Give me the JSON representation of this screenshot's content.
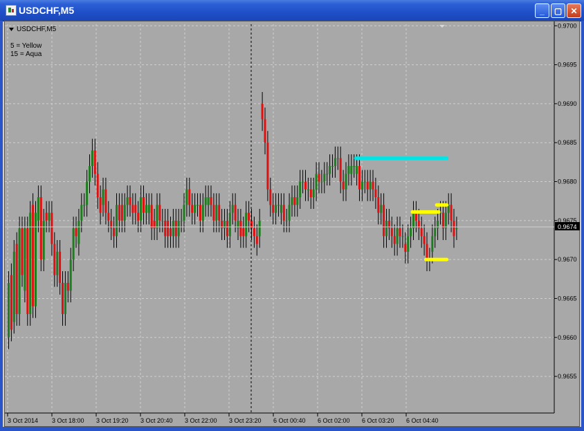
{
  "window": {
    "title": "USDCHF,M5"
  },
  "chart_header": {
    "symbol_label": "USDCHF,M5"
  },
  "legend": {
    "line1": "5 = Yellow",
    "line2": "15 = Aqua"
  },
  "current_price": "0.9674",
  "colors": {
    "bg": "#a8a8a8",
    "grid": "#d0d0d0",
    "bull": "#1e7d1e",
    "bear": "#e01010",
    "yellow": "#ffff00",
    "aqua": "#00e5e5"
  },
  "chart_data": {
    "type": "candlestick",
    "timeframe": "M5",
    "title": "USDCHF,M5",
    "ylim": [
      0.96503,
      0.97002
    ],
    "y_ticks": [
      "0.9700",
      "0.9695",
      "0.9690",
      "0.9685",
      "0.9680",
      "0.9675",
      "0.9670",
      "0.9665",
      "0.9660",
      "0.9655"
    ],
    "x_ticks": [
      "3 Oct 2014",
      "3 Oct 18:00",
      "3 Oct 19:20",
      "3 Oct 20:40",
      "3 Oct 22:00",
      "3 Oct 23:20",
      "6 Oct 00:40",
      "6 Oct 02:00",
      "6 Oct 03:20",
      "6 Oct 04:40"
    ],
    "closes": [
      0.9667,
      0.9661,
      0.9671,
      0.9663,
      0.9674,
      0.9668,
      0.9674,
      0.9663,
      0.9676,
      0.9664,
      0.9676,
      0.9678,
      0.967,
      0.9675,
      0.9675,
      0.9676,
      0.9672,
      0.9668,
      0.9671,
      0.9667,
      0.9663,
      0.9667,
      0.9666,
      0.967,
      0.9674,
      0.9673,
      0.9675,
      0.9677,
      0.9677,
      0.968,
      0.9682,
      0.9684,
      0.9681,
      0.9678,
      0.9676,
      0.9679,
      0.9676,
      0.9675,
      0.9674,
      0.9673,
      0.9677,
      0.9675,
      0.9675,
      0.9677,
      0.9678,
      0.9677,
      0.9676,
      0.9676,
      0.9675,
      0.9678,
      0.9676,
      0.9677,
      0.9677,
      0.9674,
      0.9674,
      0.9677,
      0.9675,
      0.9675,
      0.9673,
      0.9673,
      0.9673,
      0.9675,
      0.9673,
      0.9675,
      0.9675,
      0.9677,
      0.9679,
      0.9677,
      0.9676,
      0.9677,
      0.9677,
      0.9675,
      0.9677,
      0.9678,
      0.9678,
      0.9677,
      0.9675,
      0.9677,
      0.9675,
      0.9674,
      0.9675,
      0.9673,
      0.9676,
      0.9677,
      0.9675,
      0.9675,
      0.9673,
      0.9673,
      0.9676,
      0.9675,
      0.9674,
      0.9673,
      0.9672,
      0.9675,
      0.9688,
      0.9685,
      0.9679,
      0.9677,
      0.9676,
      0.9677,
      0.9677,
      0.9677,
      0.9675,
      0.9675,
      0.9677,
      0.9678,
      0.9677,
      0.9678,
      0.968,
      0.968,
      0.9679,
      0.9679,
      0.9678,
      0.9679,
      0.9681,
      0.968,
      0.968,
      0.9681,
      0.9681,
      0.9682,
      0.9682,
      0.9683,
      0.9683,
      0.968,
      0.9679,
      0.9681,
      0.9682,
      0.9682,
      0.9682,
      0.9682,
      0.9679,
      0.968,
      0.968,
      0.9679,
      0.968,
      0.9679,
      0.9678,
      0.9676,
      0.9677,
      0.9673,
      0.9675,
      0.9674,
      0.9673,
      0.9672,
      0.9674,
      0.9673,
      0.9673,
      0.9671,
      0.9673,
      0.9674,
      0.9676,
      0.9675,
      0.9674,
      0.9673,
      0.9672,
      0.967,
      0.967,
      0.9673,
      0.9674,
      0.9675,
      0.9676,
      0.9674,
      0.9676,
      0.9677,
      0.9675,
      0.9673,
      0.9674
    ],
    "opens": [
      0.966,
      0.9668,
      0.9662,
      0.9672,
      0.9663,
      0.9674,
      0.9666,
      0.9674,
      0.9663,
      0.9677,
      0.9664,
      0.9675,
      0.9678,
      0.967,
      0.9676,
      0.9675,
      0.9676,
      0.9672,
      0.9668,
      0.9671,
      0.9667,
      0.9663,
      0.9667,
      0.9666,
      0.967,
      0.9674,
      0.9672,
      0.9675,
      0.9677,
      0.9677,
      0.968,
      0.9682,
      0.9684,
      0.9681,
      0.9678,
      0.9677,
      0.9679,
      0.9676,
      0.9675,
      0.9674,
      0.9673,
      0.9677,
      0.9677,
      0.9675,
      0.9677,
      0.9678,
      0.9677,
      0.9677,
      0.9676,
      0.9675,
      0.9678,
      0.9676,
      0.9676,
      0.9677,
      0.9675,
      0.9674,
      0.9677,
      0.9675,
      0.9675,
      0.9675,
      0.9674,
      0.9673,
      0.9675,
      0.9673,
      0.9675,
      0.9675,
      0.9677,
      0.9679,
      0.9677,
      0.9676,
      0.9677,
      0.9677,
      0.9675,
      0.9677,
      0.9677,
      0.9678,
      0.9677,
      0.9675,
      0.9677,
      0.9675,
      0.9674,
      0.9675,
      0.9673,
      0.9676,
      0.9677,
      0.9674,
      0.9675,
      0.9674,
      0.9673,
      0.9676,
      0.9675,
      0.9674,
      0.9673,
      0.9673,
      0.969,
      0.9688,
      0.9685,
      0.9679,
      0.9677,
      0.9676,
      0.9677,
      0.9676,
      0.9677,
      0.9675,
      0.9675,
      0.9677,
      0.9678,
      0.9677,
      0.9678,
      0.968,
      0.968,
      0.9679,
      0.9679,
      0.9678,
      0.9679,
      0.9681,
      0.968,
      0.968,
      0.9681,
      0.9681,
      0.9682,
      0.9682,
      0.9683,
      0.9683,
      0.968,
      0.9679,
      0.9681,
      0.9681,
      0.9682,
      0.9681,
      0.9682,
      0.9679,
      0.968,
      0.968,
      0.9679,
      0.968,
      0.9679,
      0.9678,
      0.9676,
      0.9677,
      0.9673,
      0.9675,
      0.9674,
      0.9673,
      0.9672,
      0.9674,
      0.9673,
      0.9672,
      0.9671,
      0.9673,
      0.9674,
      0.9676,
      0.9675,
      0.9674,
      0.9673,
      0.9672,
      0.967,
      0.9671,
      0.9673,
      0.9674,
      0.9676,
      0.9676,
      0.9674,
      0.9676,
      0.9677,
      0.9675,
      0.9674
    ],
    "levels": [
      {
        "name": "15 = Aqua",
        "price": 0.9683,
        "from_index": 129,
        "to_index": 162,
        "color": "#00e5e5"
      },
      {
        "name": "5 = Yellow",
        "price": 0.96761,
        "from_index": 150,
        "to_index": 159,
        "color": "#ffff00"
      },
      {
        "name": "5 = Yellow",
        "price": 0.9677,
        "from_index": 159,
        "to_index": 162,
        "color": "#ffff00"
      },
      {
        "name": "5 = Yellow",
        "price": 0.967,
        "from_index": 155,
        "to_index": 162,
        "color": "#ffff00"
      }
    ]
  }
}
